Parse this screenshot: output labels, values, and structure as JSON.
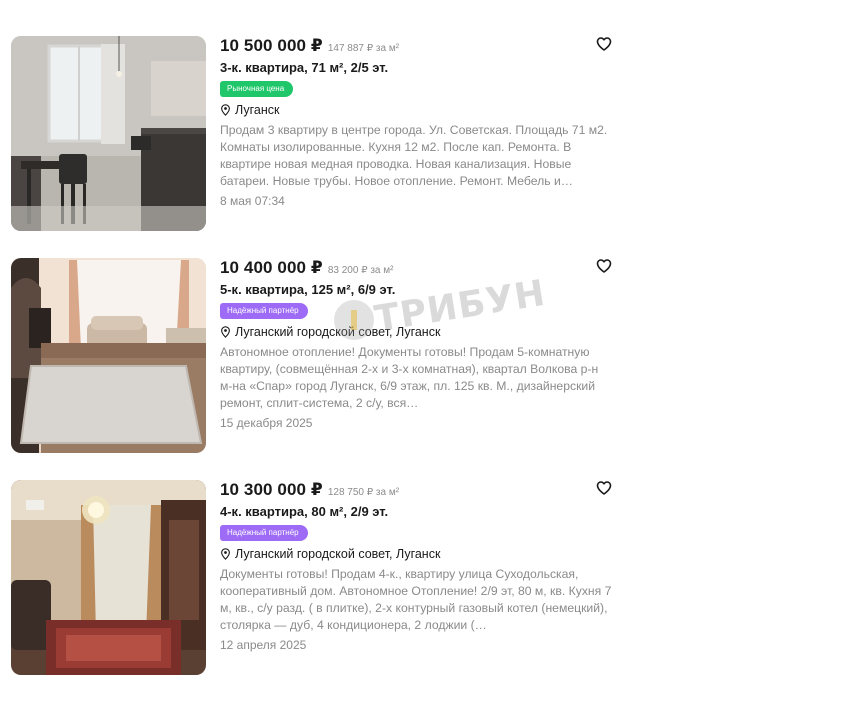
{
  "listings": [
    {
      "price": "10 500 000 ₽",
      "price_per_m2": "147 887 ₽ за м²",
      "title": "3-к. квартира, 71 м², 2/5 эт.",
      "badge": "Рыночная цена",
      "badge_color": "#1fc76a",
      "location": "Луганск",
      "description": "Продам 3 квартиру в центре города. Ул. Советская. Площадь 71 м2. Комнаты изолированные. Кухня 12 м2. После кап. Ремонта. В квартире новая медная проводка. Новая канализация. Новые батареи. Новые трубы. Новое отопление. Ремонт. Мебель и…",
      "date": "8 мая 07:34",
      "photo": "kitchen-photo"
    },
    {
      "price": "10 400 000 ₽",
      "price_per_m2": "83 200 ₽ за м²",
      "title": "5-к. квартира, 125 м², 6/9 эт.",
      "badge": "Надёжный партнёр",
      "badge_color": "#9d6bf5",
      "location": "Луганский городской совет, Луганск",
      "description": "Автономное отопление! Документы готовы! Продам 5-комнатную квартиру, (совмещённая 2-х и 3-х комнатная), квартал Волкова р-н м-на «Спар» город Луганск, 6/9 этаж, пл. 125 кв. М., дизайнерский ремонт, сплит-система, 2 с/у, вся…",
      "date": "15 декабря 2025",
      "photo": "living-room-photo"
    },
    {
      "price": "10 300 000 ₽",
      "price_per_m2": "128 750 ₽ за м²",
      "title": "4-к. квартира, 80 м², 2/9 эт.",
      "badge": "Надёжный партнёр",
      "badge_color": "#9d6bf5",
      "location": "Луганский городской совет, Луганск",
      "description": "Документы готовы! Продам 4-к., квартиру улица Суходольская, кооперативный дом. Автономное Отопление! 2/9 эт, 80 м, кв. Кухня 7 м, кв., с/у разд. ( в плитке), 2-х контурный газовый котел (немецкий), столярка — дуб, 4 кондиционера, 2 лоджии (…",
      "date": "12 апреля 2025",
      "photo": "chandelier-room-photo"
    }
  ],
  "watermark": "ТРИБУН",
  "icons": {
    "favorite": "heart-outline-icon",
    "location": "map-pin-icon"
  }
}
